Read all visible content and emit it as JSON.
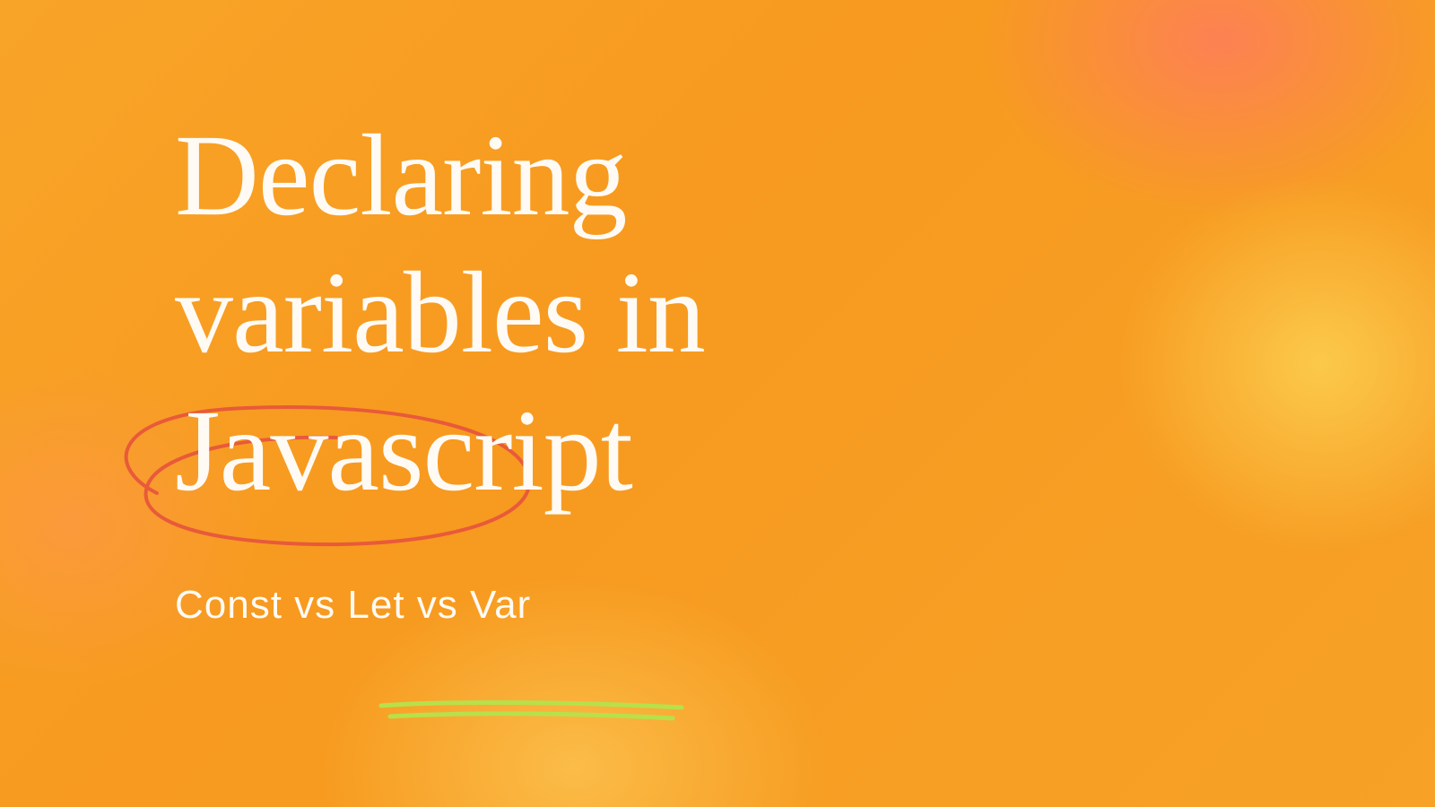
{
  "title_line1": "Declaring",
  "title_line2": "variables in",
  "title_line3": "Javascript",
  "subtitle": "Const vs Let vs Var",
  "colors": {
    "background_base": "#f7a127",
    "text": "#fffaf4",
    "circle_stroke": "#e85a3a",
    "underline_stroke": "#b8e04a"
  }
}
